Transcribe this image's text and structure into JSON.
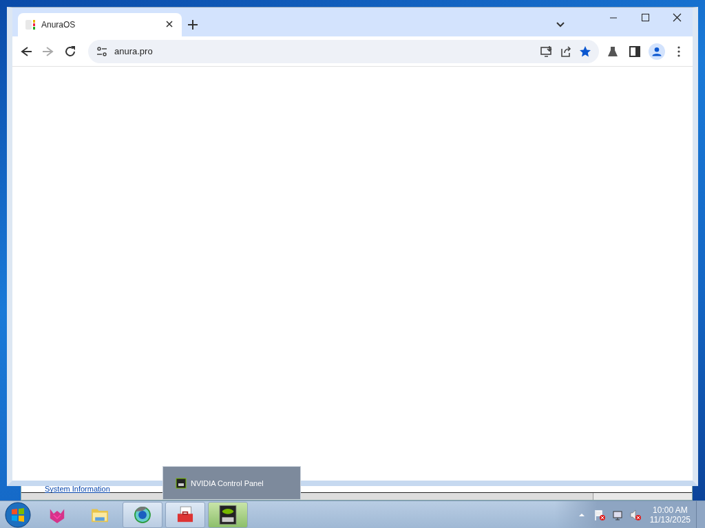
{
  "background_window": {
    "link": "System Information"
  },
  "browser": {
    "tabs": [
      {
        "title": "AnuraOS",
        "selected": true
      }
    ],
    "address": "anura.pro",
    "bookmarked": true
  },
  "taskbar": {
    "items": [
      {
        "kind": "fox",
        "running": false,
        "hovered": false
      },
      {
        "kind": "folder",
        "running": false,
        "hovered": false
      },
      {
        "kind": "globe",
        "running": true,
        "hovered": false
      },
      {
        "kind": "toolbox",
        "running": true,
        "hovered": false
      },
      {
        "kind": "gpu",
        "running": true,
        "hovered": true
      }
    ],
    "preview": {
      "label": "NVIDIA Control Panel"
    },
    "clock": {
      "time": "10:00 AM",
      "date": "11/13/2025"
    }
  }
}
